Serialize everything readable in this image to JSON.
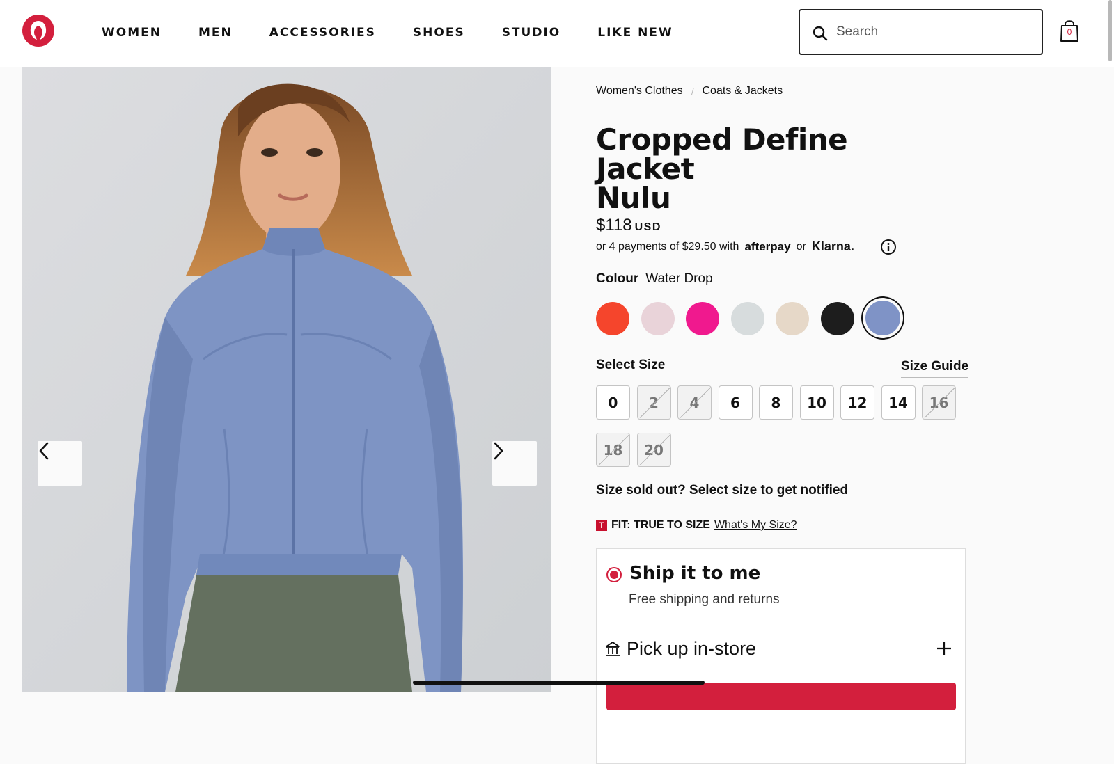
{
  "header": {
    "nav": [
      "WOMEN",
      "MEN",
      "ACCESSORIES",
      "SHOES",
      "STUDIO",
      "LIKE NEW"
    ],
    "search_placeholder": "Search",
    "bag_count": "0",
    "brand_color": "#d31f3d"
  },
  "gallery": {
    "prev_icon": "chevron-left-icon",
    "next_icon": "chevron-right-icon"
  },
  "product": {
    "breadcrumb": [
      "Women's Clothes",
      "Coats & Jackets"
    ],
    "title_lines": [
      "Cropped Define",
      "Jacket",
      "Nulu"
    ],
    "price": "$118",
    "currency": "USD",
    "payments_text": "or 4 payments of $29.50 with",
    "payments_afterpay": "afterpay",
    "payments_or": "or",
    "payments_klarna": "Klarna.",
    "colour_label": "Colour",
    "colour_value": "Water Drop",
    "swatches": [
      {
        "color": "#f5452c",
        "selected": false
      },
      {
        "color": "#e9d3d9",
        "selected": false
      },
      {
        "color": "#f0198e",
        "selected": false
      },
      {
        "color": "#d7dcdd",
        "selected": false
      },
      {
        "color": "#e6d8c8",
        "selected": false
      },
      {
        "color": "#1d1d1d",
        "selected": false
      },
      {
        "color": "#7f93c6",
        "selected": true
      }
    ],
    "size_label": "Select Size",
    "size_guide": "Size Guide",
    "sizes": [
      {
        "label": "0",
        "available": true
      },
      {
        "label": "2",
        "available": false
      },
      {
        "label": "4",
        "available": false
      },
      {
        "label": "6",
        "available": true
      },
      {
        "label": "8",
        "available": true
      },
      {
        "label": "10",
        "available": true
      },
      {
        "label": "12",
        "available": true
      },
      {
        "label": "14",
        "available": true
      },
      {
        "label": "16",
        "available": false
      },
      {
        "label": "18",
        "available": false
      },
      {
        "label": "20",
        "available": false
      }
    ],
    "soldout_note": "Size sold out? Select size to get notified",
    "fit_badge": "T",
    "fit_text": "FIT: TRUE TO SIZE",
    "fit_link": "What's My Size?",
    "ship_title": "Ship it to me",
    "ship_sub": "Free shipping and returns",
    "pickup_title": "Pick up in-store"
  }
}
